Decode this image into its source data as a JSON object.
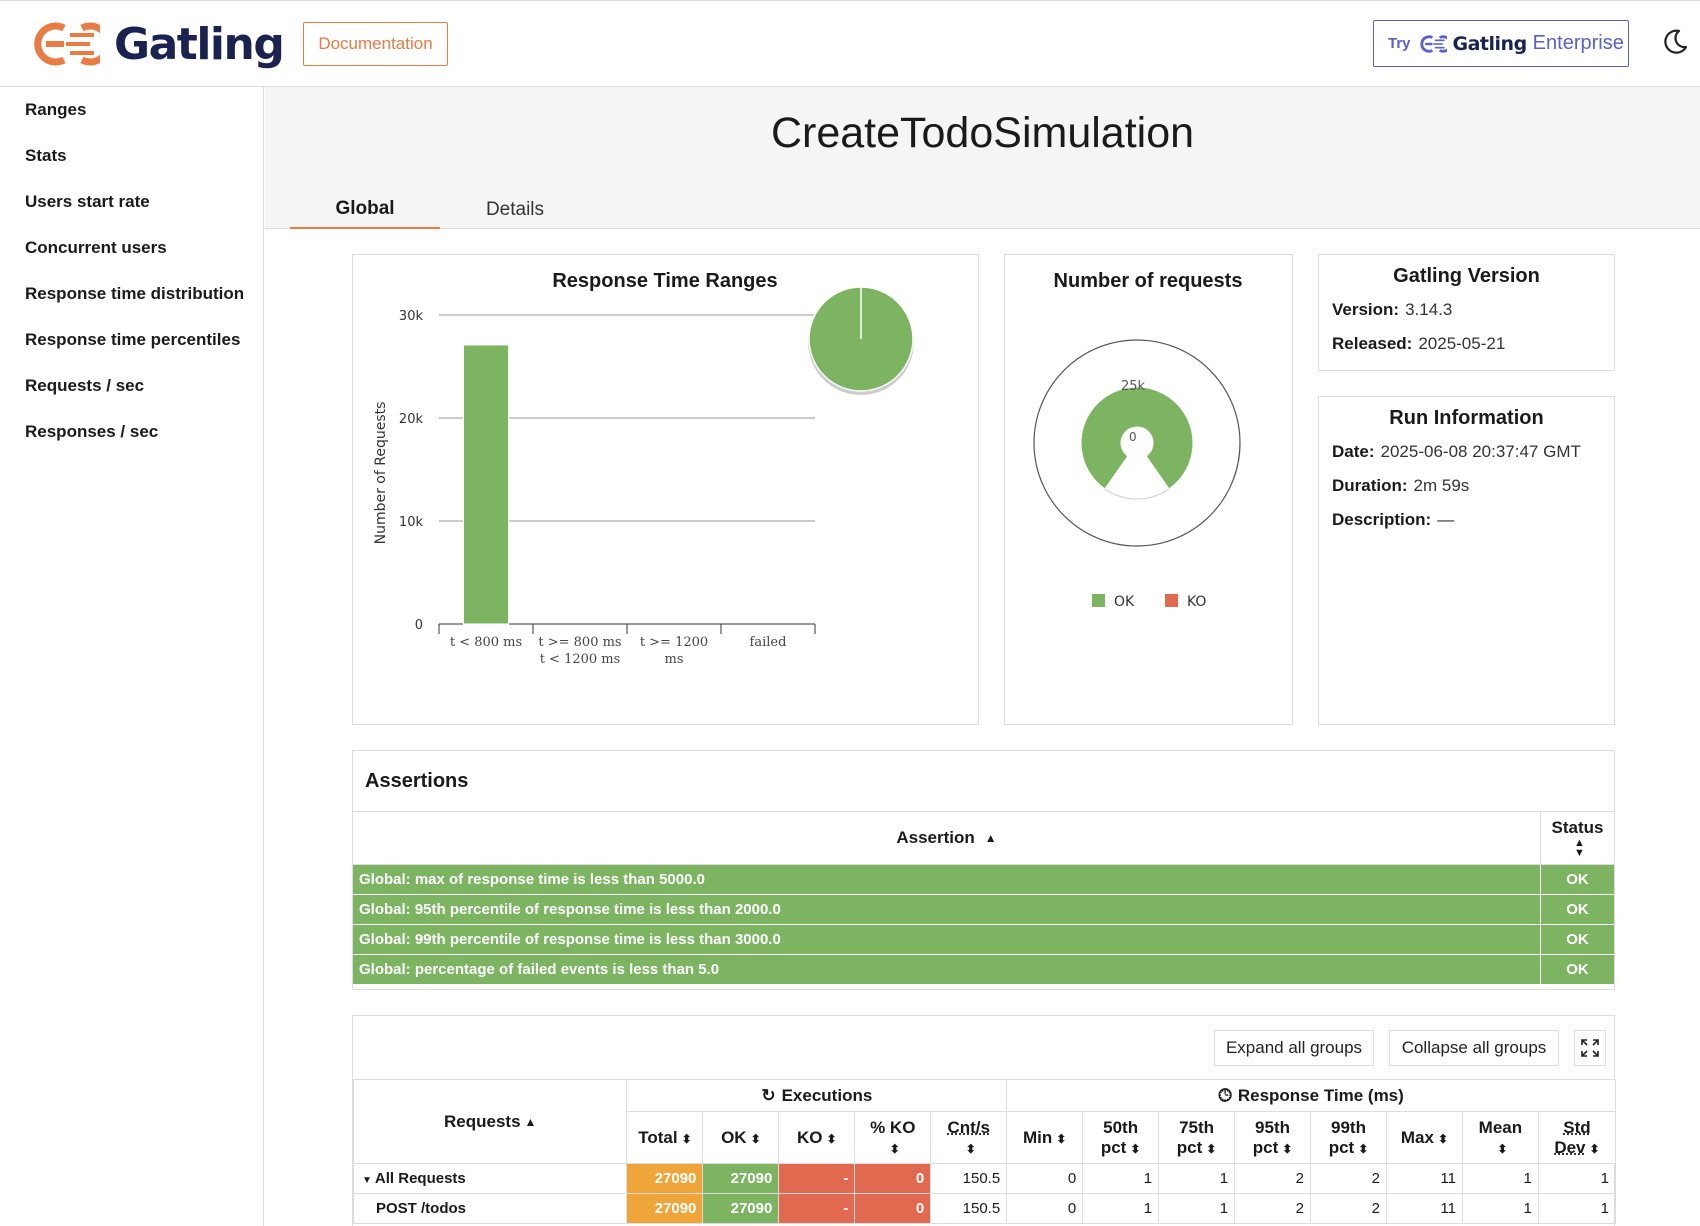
{
  "header": {
    "brand": "Gatling",
    "documentation_label": "Documentation",
    "enterprise_try": "Try",
    "enterprise_gatling": "Gatling",
    "enterprise_word": "Enterprise"
  },
  "sidebar": {
    "items": [
      {
        "label": "Ranges"
      },
      {
        "label": "Stats"
      },
      {
        "label": "Users start rate"
      },
      {
        "label": "Concurrent users"
      },
      {
        "label": "Response time distribution"
      },
      {
        "label": "Response time percentiles"
      },
      {
        "label": "Requests / sec"
      },
      {
        "label": "Responses / sec"
      }
    ]
  },
  "page": {
    "title": "CreateTodoSimulation",
    "tabs": [
      {
        "label": "Global"
      },
      {
        "label": "Details"
      }
    ]
  },
  "colors": {
    "ok": "#7cb462",
    "ko": "#e1694f",
    "total": "#f0a53a",
    "accent": "#e97b44",
    "enterprise": "#5b5fc7"
  },
  "chart_data": [
    {
      "type": "bar",
      "title": "Response Time Ranges",
      "ylabel": "Number of Requests",
      "xlabel": "",
      "categories": [
        "t < 800 ms",
        "t >= 800 ms\nt < 1200 ms",
        "t >= 1200\nms",
        "failed"
      ],
      "values": [
        27090,
        0,
        0,
        0
      ],
      "ylim": [
        0,
        30000
      ],
      "y_ticks": [
        "0",
        "10k",
        "20k",
        "30k"
      ],
      "grid": true,
      "inset_pie": {
        "values": [
          27090
        ],
        "colors": [
          "#7cb462"
        ]
      }
    },
    {
      "type": "pie",
      "title": "Number of requests",
      "series": [
        {
          "name": "OK",
          "value": 27090
        },
        {
          "name": "KO",
          "value": 0
        }
      ],
      "radial_ticks": [
        "25k",
        "0"
      ],
      "legend": [
        "OK",
        "KO"
      ],
      "legend_position": "bottom"
    }
  ],
  "gatling_version": {
    "title": "Gatling Version",
    "version_label": "Version:",
    "version": "3.14.3",
    "released_label": "Released:",
    "released": "2025-05-21"
  },
  "run_info": {
    "title": "Run Information",
    "date_label": "Date:",
    "date": "2025-06-08 20:37:47 GMT",
    "duration_label": "Duration:",
    "duration": "2m 59s",
    "description_label": "Description:",
    "description": "—"
  },
  "assertions": {
    "title": "Assertions",
    "col_assertion": "Assertion",
    "col_status": "Status",
    "rows": [
      {
        "text": "Global: max of response time is less than 5000.0",
        "status": "OK"
      },
      {
        "text": "Global: 95th percentile of response time is less than 2000.0",
        "status": "OK"
      },
      {
        "text": "Global: 99th percentile of response time is less than 3000.0",
        "status": "OK"
      },
      {
        "text": "Global: percentage of failed events is less than 5.0",
        "status": "OK"
      }
    ]
  },
  "stats": {
    "expand_label": "Expand all groups",
    "collapse_label": "Collapse all groups",
    "requests_header": "Requests",
    "executions_header": "Executions",
    "response_time_header": "Response Time (ms)",
    "cols": {
      "total": "Total",
      "ok": "OK",
      "ko": "KO",
      "pct_ko": "% KO",
      "cnts": "Cnt/s",
      "min": "Min",
      "p50a": "50th",
      "p50b": "pct",
      "p75a": "75th",
      "p75b": "pct",
      "p95a": "95th",
      "p95b": "pct",
      "p99a": "99th",
      "p99b": "pct",
      "max": "Max",
      "mean": "Mean",
      "stda": "Std",
      "stdb": "Dev"
    },
    "rows": [
      {
        "name": "All Requests",
        "total": "27090",
        "ok": "27090",
        "ko": "-",
        "pct_ko": "0",
        "cnts": "150.5",
        "min": "0",
        "p50": "1",
        "p75": "1",
        "p95": "2",
        "p99": "2",
        "max": "11",
        "mean": "1",
        "std": "1"
      },
      {
        "name": "POST /todos",
        "total": "27090",
        "ok": "27090",
        "ko": "-",
        "pct_ko": "0",
        "cnts": "150.5",
        "min": "0",
        "p50": "1",
        "p75": "1",
        "p95": "2",
        "p99": "2",
        "max": "11",
        "mean": "1",
        "std": "1"
      }
    ]
  }
}
